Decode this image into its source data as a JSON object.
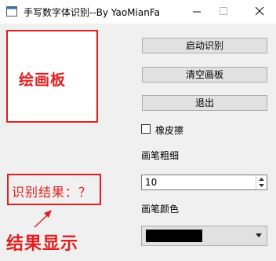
{
  "window": {
    "title": "手写数字体识别--By YaoMianFa",
    "icon": "window-app-icon",
    "controls": [
      "minimize-icon",
      "maximize-icon",
      "close-icon"
    ]
  },
  "annotations": {
    "canvas_label": "绘画板",
    "result_text": "识别结果：？",
    "result_note": "结果显示",
    "color": "#e02020"
  },
  "buttons": {
    "start": "启动识别",
    "clear": "清空画板",
    "exit": "退出"
  },
  "eraser": {
    "label": "橡皮擦",
    "checked": false
  },
  "pen_width": {
    "label": "画笔粗细",
    "value": "10"
  },
  "pen_color": {
    "label": "画笔颜色",
    "selected_color": "#000000"
  }
}
